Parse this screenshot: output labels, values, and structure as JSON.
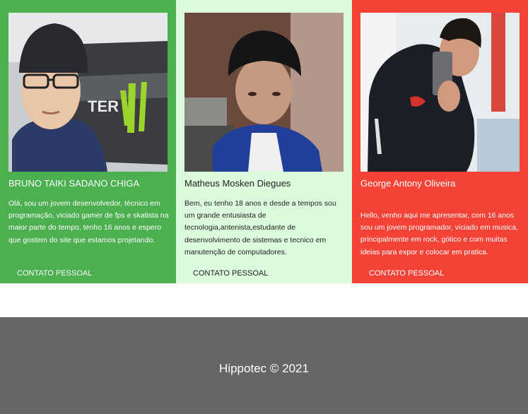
{
  "team": {
    "members": [
      {
        "name": "BRUNO TAIKI SADANO CHIGA",
        "bio": "Olá, sou um jovem desenvolvedor, técnico em programação, viciado gamer de fps e skatista na maior parte do tempo, tenho 16 anos e espero que gostem do site que estamos projetando.",
        "contact_label": "CONTATO PESSOAL",
        "color": "#4caf50"
      },
      {
        "name": "Matheus Mosken Diegues",
        "bio": "Bem, eu tenho 18 anos e desde a tempos sou um grande entusiasta de tecnologia,antenista,estudante de desenvolvimento de sistemas e tecnico em manutenção de computadores.",
        "contact_label": "CONTATO PESSOAL",
        "color": "#dcfadc"
      },
      {
        "name": "George Antony Oliveira",
        "bio": "Hello, venho aqui me apresentar, com 16 anos sou um jovem programador, viciado em musica, principalmente em rock, gótico e com muitas ideias para expor e colocar em pratica.",
        "contact_label": "CONTATO PESSOAL",
        "color": "#f44336"
      }
    ]
  },
  "footer": {
    "text": "Hippotec © 2021",
    "background": "#666666"
  }
}
